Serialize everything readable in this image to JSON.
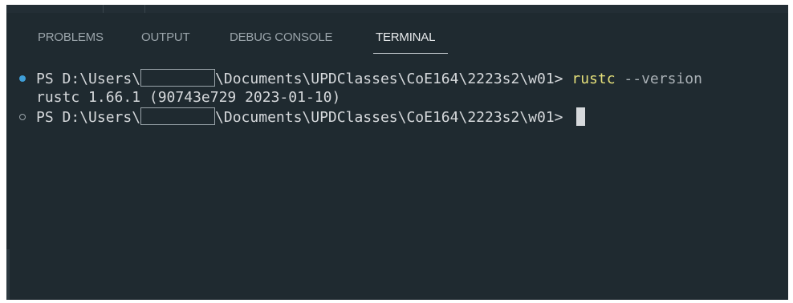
{
  "panel": {
    "tabs": [
      {
        "label": "PROBLEMS",
        "active": false
      },
      {
        "label": "OUTPUT",
        "active": false
      },
      {
        "label": "DEBUG CONSOLE",
        "active": false
      },
      {
        "label": "TERMINAL",
        "active": true
      }
    ]
  },
  "terminal": {
    "lines": [
      {
        "status": "success",
        "prompt_prefix": "PS D:\\Users\\",
        "prompt_suffix": "\\Documents\\UPDClasses\\CoE164\\2223s2\\w01> ",
        "command": "rustc",
        "args": " --version"
      },
      {
        "output": "rustc 1.66.1 (90743e729 2023-01-10)"
      },
      {
        "status": "idle",
        "prompt_prefix": "PS D:\\Users\\",
        "prompt_suffix": "\\Documents\\UPDClasses\\CoE164\\2223s2\\w01> "
      }
    ]
  },
  "colors": {
    "background": "#1f2a30",
    "command": "#e5e07a",
    "success_marker": "#3f9fd8"
  }
}
